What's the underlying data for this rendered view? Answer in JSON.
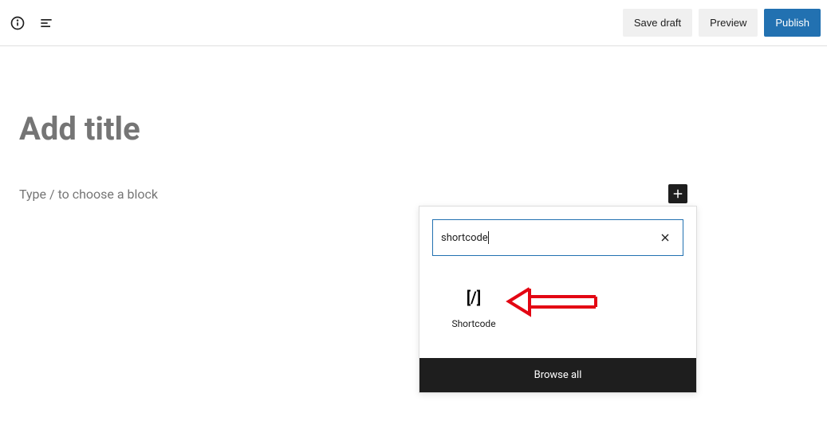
{
  "toolbar": {
    "save_draft": "Save draft",
    "preview": "Preview",
    "publish": "Publish"
  },
  "editor": {
    "title_placeholder": "Add title",
    "block_prompt": "Type / to choose a block"
  },
  "inserter": {
    "search_value": "shortcode",
    "results": [
      {
        "label": "Shortcode",
        "icon": "[/]"
      }
    ],
    "browse_all": "Browse all"
  }
}
